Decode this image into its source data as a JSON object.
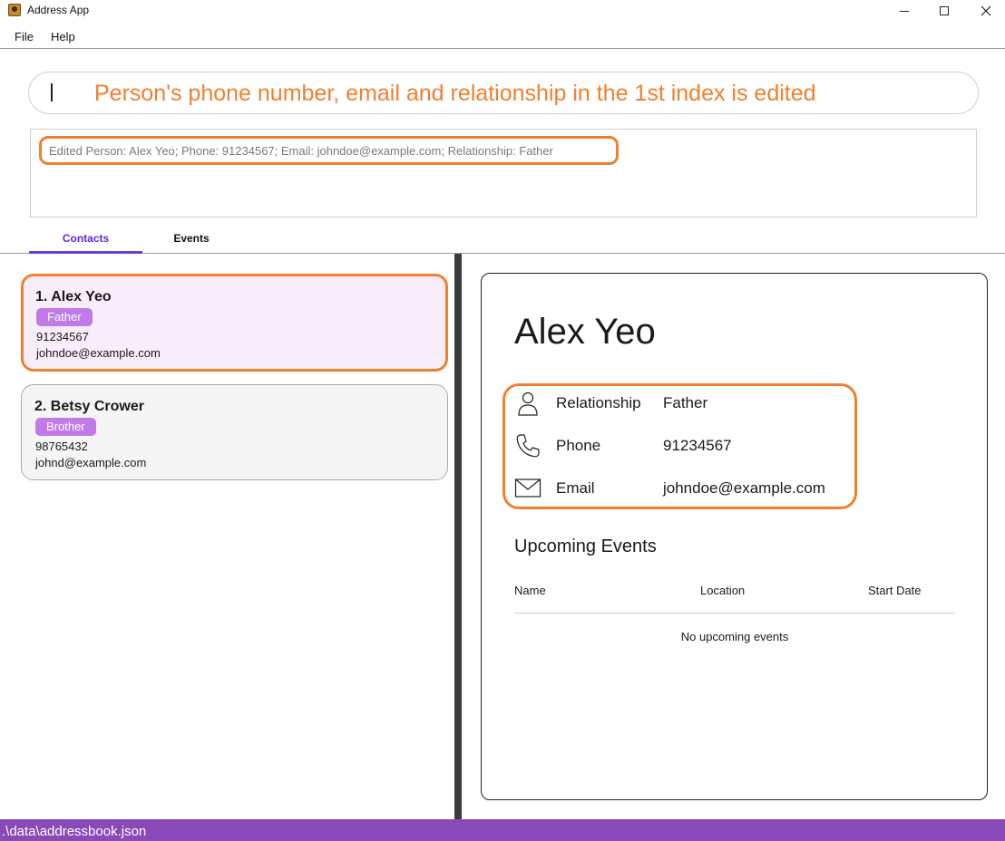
{
  "window": {
    "title": "Address App"
  },
  "menu": {
    "file": "File",
    "help": "Help"
  },
  "command": {
    "text": "Person's phone number, email and relationship in the 1st index is edited"
  },
  "result": {
    "text": "Edited Person: Alex Yeo; Phone: 91234567; Email: johndoe@example.com; Relationship: Father"
  },
  "tabs": {
    "contacts": "Contacts",
    "events": "Events",
    "active": "Contacts"
  },
  "contacts": [
    {
      "name": "1. Alex Yeo",
      "relationship": "Father",
      "phone": "91234567",
      "email": "johndoe@example.com",
      "selected": true
    },
    {
      "name": "2. Betsy Crower",
      "relationship": "Brother",
      "phone": "98765432",
      "email": "johnd@example.com",
      "selected": false
    }
  ],
  "detail": {
    "name": "Alex Yeo",
    "relationship_label": "Relationship",
    "relationship_value": "Father",
    "phone_label": "Phone",
    "phone_value": "91234567",
    "email_label": "Email",
    "email_value": "johndoe@example.com",
    "events_heading": "Upcoming Events",
    "columns": {
      "name": "Name",
      "location": "Location",
      "start_date": "Start Date"
    },
    "empty_message": "No upcoming events"
  },
  "status": {
    "path": ".\\data\\addressbook.json"
  },
  "icons": {
    "app": "address-book-icon",
    "relationship": "person-icon",
    "phone": "phone-icon",
    "email": "envelope-icon",
    "minimize": "minimize-icon",
    "maximize": "maximize-icon",
    "close": "close-icon"
  },
  "colors": {
    "accent_orange": "#f0802e",
    "badge_purple": "#c17be8",
    "tab_active": "#5b2bd9",
    "status_bar": "#8a49b8",
    "selected_card": "#f8eefb"
  }
}
